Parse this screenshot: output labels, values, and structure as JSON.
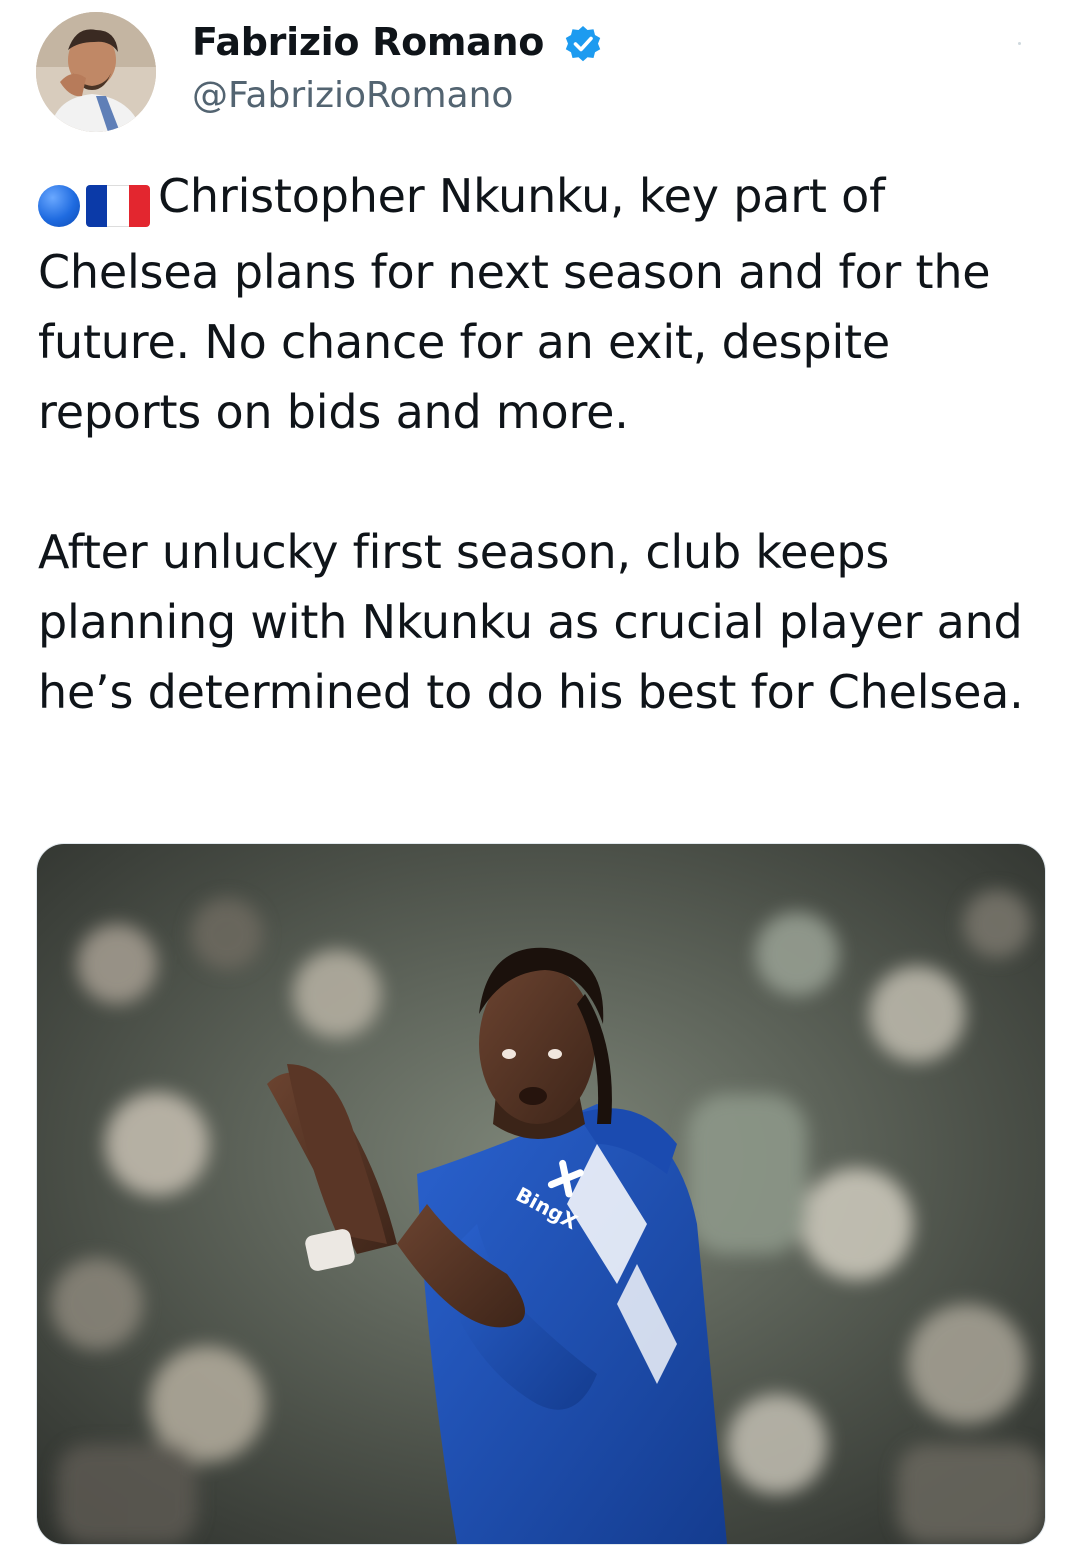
{
  "author": {
    "display_name": "Fabrizio Romano",
    "handle": "@FabrizioRomano",
    "verified": true,
    "avatar_icon": "profile-photo"
  },
  "tweet": {
    "emoji_prefix": [
      "blue-circle-icon",
      "flag-france-icon"
    ],
    "paragraphs": [
      "Christopher Nkunku, key part of Chelsea plans for next season and for the future. No chance for an exit, despite reports on bids and more.",
      "After unlucky first season, club keeps planning with Nkunku as crucial player and he’s determined to do his best for Chelsea."
    ]
  },
  "media": {
    "type": "photo",
    "shirt_sponsor": "BingX",
    "colors": {
      "jersey": "#1c4fb3",
      "crowd_dark": "#3b3f3a",
      "crowd_light": "#8d978c"
    }
  },
  "colors": {
    "text": "#0f1419",
    "secondary": "#536471",
    "verified": "#1d9bf0",
    "flag_blue": "#0b3aa8",
    "flag_white": "#ffffff",
    "flag_red": "#e3262f"
  }
}
